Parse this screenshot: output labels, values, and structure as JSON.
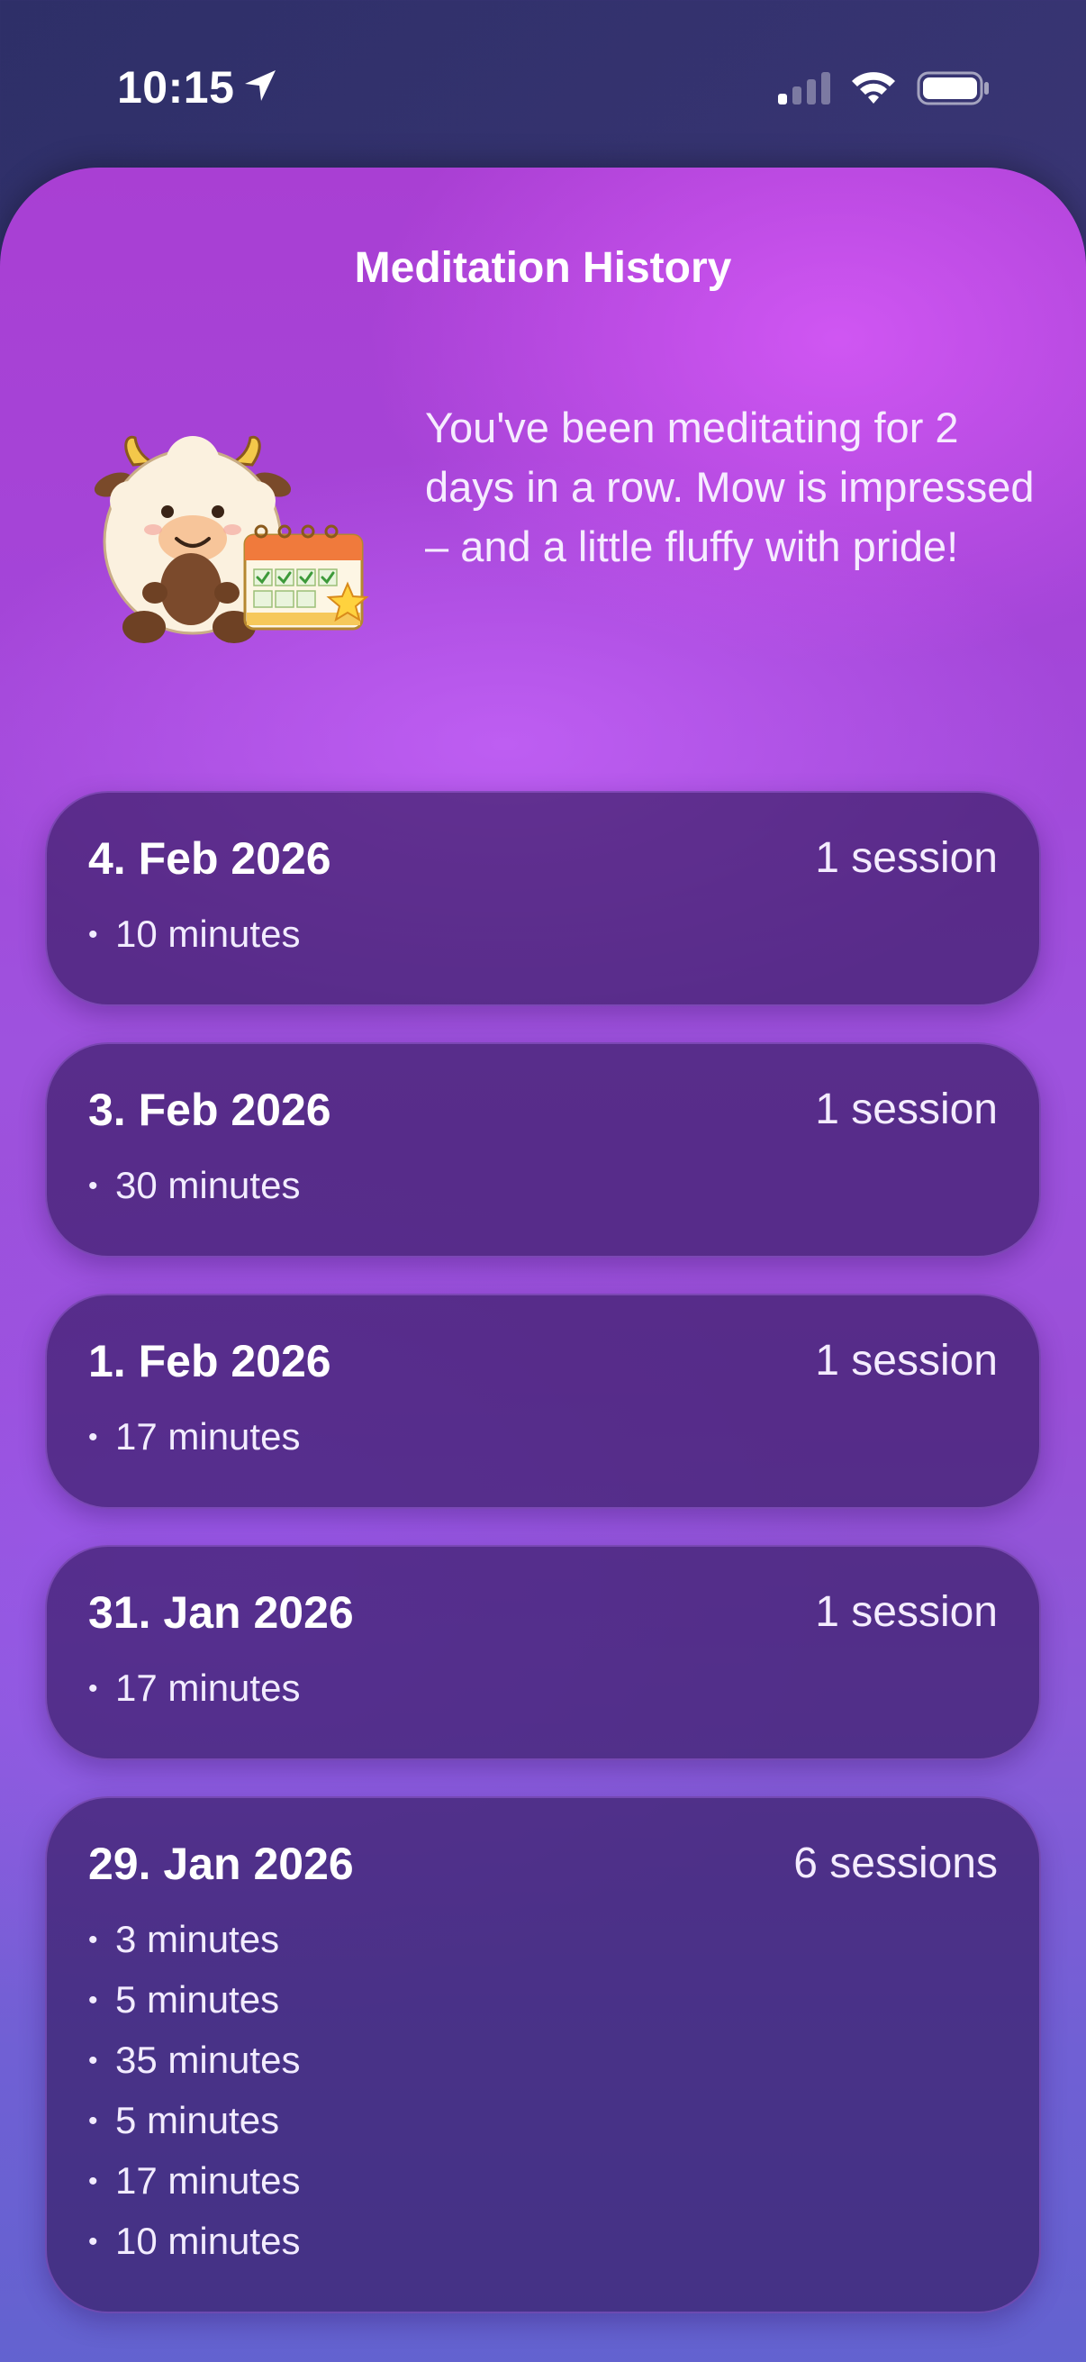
{
  "status_bar": {
    "time": "10:15"
  },
  "screen": {
    "title": "Meditation History",
    "streak_message": "You've been meditating for 2 days in a row. Mow is impressed – and a little fluffy with pride!"
  },
  "history": [
    {
      "date": "4. Feb 2026",
      "count_label": "1 session",
      "sessions": [
        "10 minutes"
      ]
    },
    {
      "date": "3. Feb 2026",
      "count_label": "1 session",
      "sessions": [
        "30 minutes"
      ]
    },
    {
      "date": "1. Feb 2026",
      "count_label": "1 session",
      "sessions": [
        "17 minutes"
      ]
    },
    {
      "date": "31. Jan 2026",
      "count_label": "1 session",
      "sessions": [
        "17 minutes"
      ]
    },
    {
      "date": "29. Jan 2026",
      "count_label": "6 sessions",
      "sessions": [
        "3 minutes",
        "5 minutes",
        "35 minutes",
        "5 minutes",
        "17 minutes",
        "10 minutes"
      ]
    }
  ],
  "icons": {
    "location": "location-arrow-icon",
    "signal": "cellular-signal-icon",
    "wifi": "wifi-icon",
    "battery": "battery-icon",
    "mascot": "mow-mascot-with-calendar"
  }
}
